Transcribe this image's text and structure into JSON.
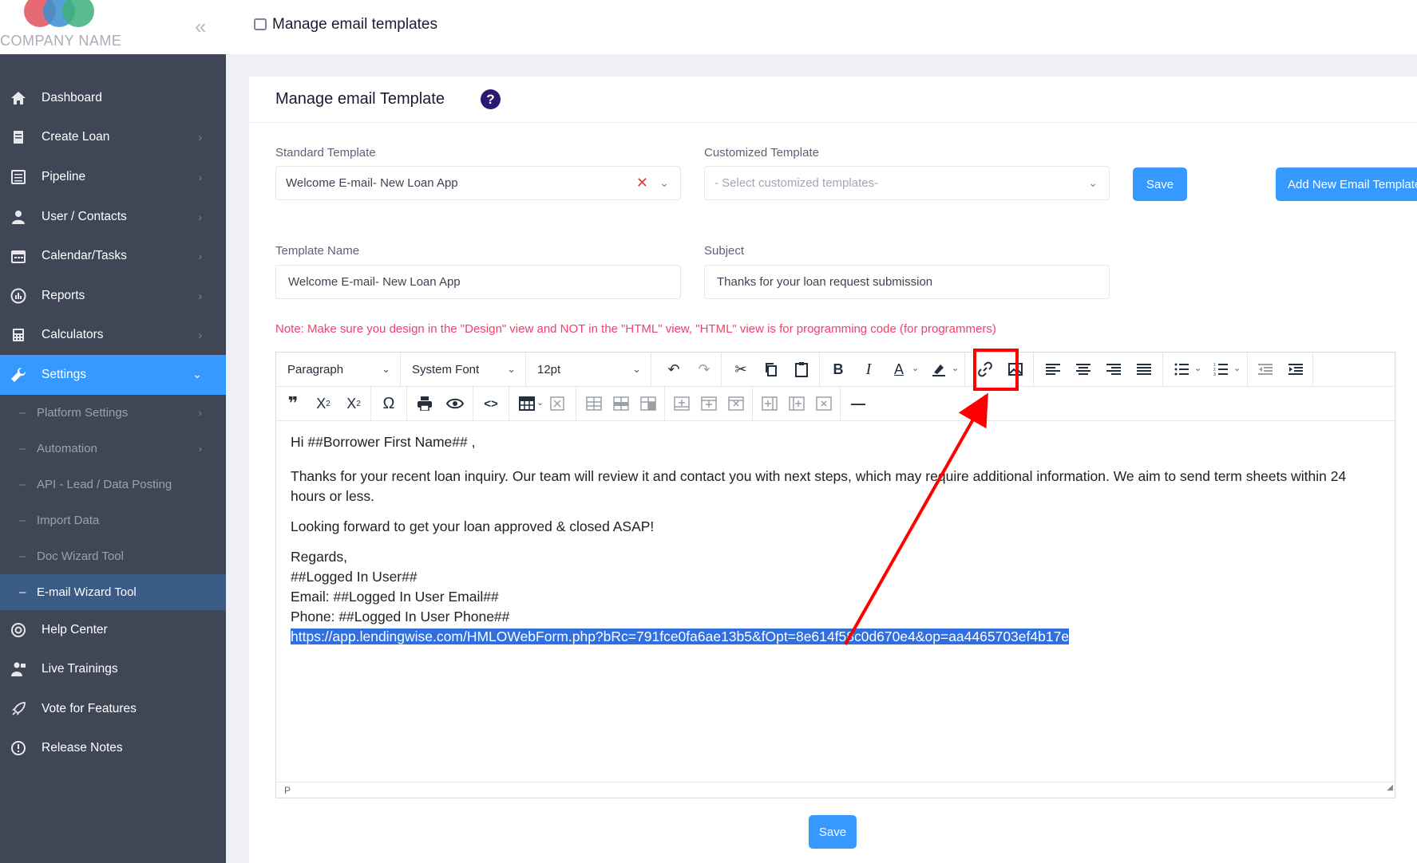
{
  "logo": {
    "text": "COMPANY NAME",
    "colors": [
      "#e0505a",
      "#3a8fd0",
      "#3db07a"
    ]
  },
  "header": {
    "title": "Manage email templates"
  },
  "sidebar": {
    "items": [
      {
        "label": "Dashboard",
        "icon": "home-icon"
      },
      {
        "label": "Create Loan",
        "icon": "document-icon"
      },
      {
        "label": "Pipeline",
        "icon": "list-icon"
      },
      {
        "label": "User / Contacts",
        "icon": "user-icon"
      },
      {
        "label": "Calendar/Tasks",
        "icon": "calendar-icon"
      },
      {
        "label": "Reports",
        "icon": "chart-icon"
      },
      {
        "label": "Calculators",
        "icon": "calculator-icon"
      },
      {
        "label": "Settings",
        "icon": "wrench-icon"
      }
    ],
    "sub_items": [
      {
        "label": "Platform Settings"
      },
      {
        "label": "Automation"
      },
      {
        "label": "API - Lead / Data Posting"
      },
      {
        "label": "Import Data"
      },
      {
        "label": "Doc Wizard Tool"
      },
      {
        "label": "E-mail Wizard Tool"
      }
    ],
    "bottom_items": [
      {
        "label": "Help Center",
        "icon": "help-icon"
      },
      {
        "label": "Live Trainings",
        "icon": "trainer-icon"
      },
      {
        "label": "Vote for Features",
        "icon": "rocket-icon"
      },
      {
        "label": "Release Notes",
        "icon": "info-icon"
      }
    ]
  },
  "card": {
    "title": "Manage email Template",
    "help": "?",
    "standard_label": "Standard Template",
    "standard_value": "Welcome E-mail- New Loan App",
    "custom_label": "Customized Template",
    "custom_placeholder": "- Select customized templates-",
    "save_label": "Save",
    "add_new_label": "Add New Email Template",
    "name_label": "Template Name",
    "name_value": "Welcome E-mail- New Loan App",
    "subject_label": "Subject",
    "subject_value": "Thanks for your loan request submission",
    "note": "Note: Make sure you design in the \"Design\" view and NOT in the \"HTML\" view, \"HTML\" view is for programming code (for programmers)",
    "bottom_save_label": "Save"
  },
  "editor": {
    "block_format": "Paragraph",
    "font_family": "System Font",
    "font_size": "12pt",
    "status_path": "P",
    "body": {
      "greeting": "Hi ##Borrower First Name## ,",
      "paragraph1": "Thanks for your recent loan inquiry. Our team will review it and contact you with next steps, which may require additional information. We aim to send term sheets within 24 hours or less.",
      "paragraph2": "Looking forward to get your loan approved & closed ASAP!",
      "regards": "Regards,",
      "sig_user": "##Logged In User##",
      "sig_email": "Email: ##Logged In User Email##",
      "sig_phone": "Phone: ##Logged In User Phone##",
      "link": "https://app.lendingwise.com/HMLOWebForm.php?bRc=791fce0fa6ae13b5&fOpt=8e614f58c0d670e4&op=aa4465703ef4b17e"
    }
  },
  "colors": {
    "accent": "#3699ff",
    "sidebar": "#3f4655",
    "annotation": "#ff0000"
  }
}
